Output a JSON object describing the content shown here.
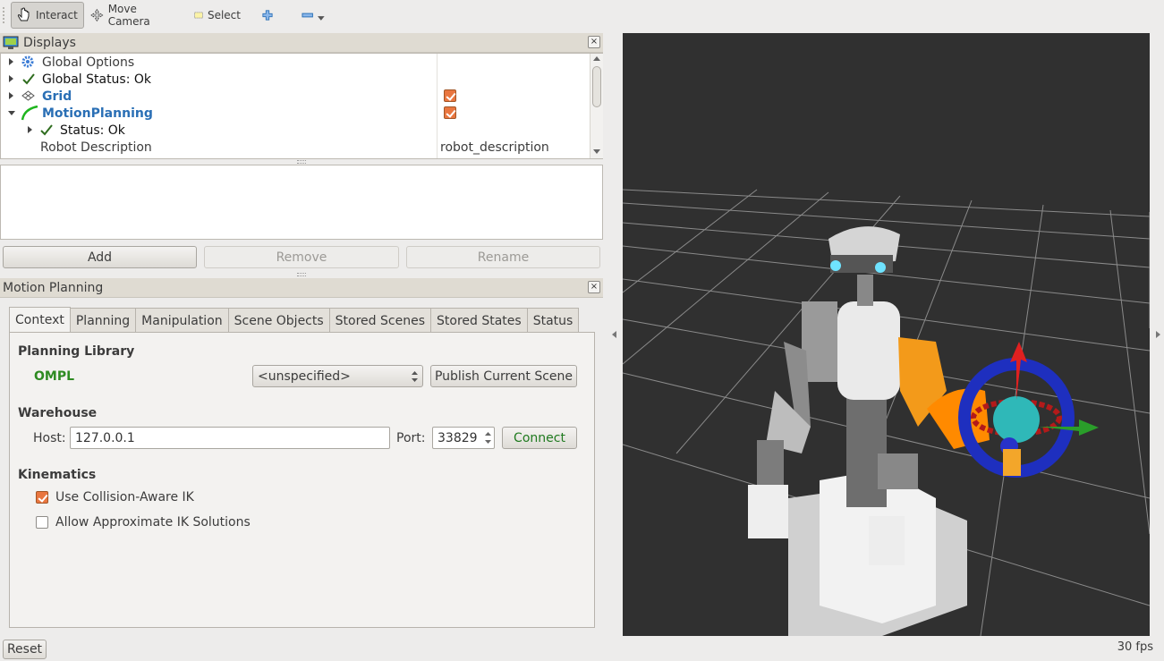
{
  "toolbar": {
    "interact": "Interact",
    "move_camera": "Move Camera",
    "select": "Select"
  },
  "displays": {
    "title": "Displays",
    "close": "×",
    "rows": [
      {
        "label": "Global Options",
        "value": ""
      },
      {
        "label": "Global Status: Ok",
        "value": ""
      },
      {
        "label": "Grid",
        "value": "",
        "checked": true
      },
      {
        "label": "MotionPlanning",
        "value": "",
        "checked": true
      },
      {
        "label": "Status: Ok",
        "value": ""
      },
      {
        "label": "Robot Description",
        "value": "robot_description"
      }
    ],
    "buttons": {
      "add": "Add",
      "remove": "Remove",
      "rename": "Rename"
    }
  },
  "motion_planning": {
    "title": "Motion Planning",
    "close": "×",
    "tabs": [
      "Context",
      "Planning",
      "Manipulation",
      "Scene Objects",
      "Stored Scenes",
      "Stored States",
      "Status"
    ],
    "active_tab": "Context",
    "planning_library": {
      "heading": "Planning Library",
      "library": "OMPL",
      "planner": "<unspecified>",
      "publish_button": "Publish Current Scene"
    },
    "warehouse": {
      "heading": "Warehouse",
      "host_label": "Host:",
      "host_value": "127.0.0.1",
      "port_label": "Port:",
      "port_value": "33829",
      "connect_button": "Connect"
    },
    "kinematics": {
      "heading": "Kinematics",
      "collision_aware_label": "Use Collision-Aware IK",
      "collision_aware_checked": true,
      "approx_label": "Allow Approximate IK Solutions",
      "approx_checked": false
    }
  },
  "status_bar": {
    "reset": "Reset",
    "fps": "30 fps"
  },
  "colors": {
    "accent_blue": "#2a6fb5",
    "ompl_green": "#2e8b22",
    "connect_green": "#1f7a1f",
    "checkbox_orange": "#e9763f",
    "viewport_bg": "#303030"
  }
}
